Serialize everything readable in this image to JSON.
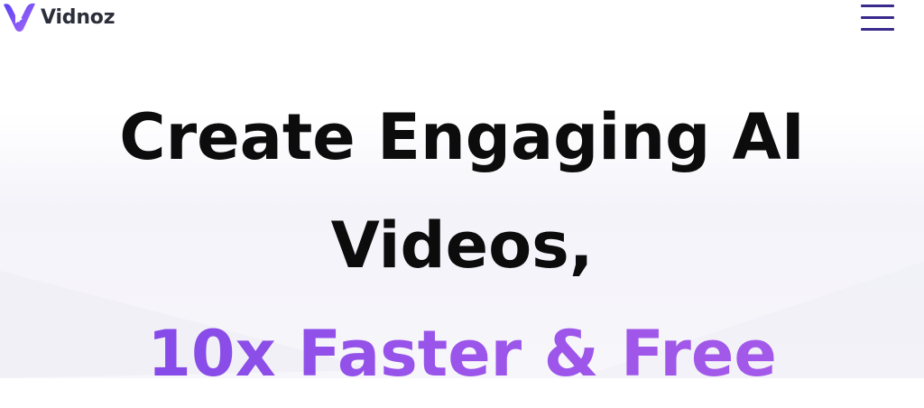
{
  "brand": {
    "name": "Vidnoz",
    "logo_colors": [
      "#5b3ff5",
      "#a56cf7",
      "#ffffff"
    ],
    "text_color": "#2b2f3a"
  },
  "nav": {
    "menu_icon": "hamburger-icon",
    "menu_color": "#3a2a8c"
  },
  "hero": {
    "line1": "Create Engaging AI",
    "line2": "Videos,",
    "line3": "10x Faster & Free",
    "text_color": "#0c0c0d",
    "accent_gradient": [
      "#7a45e6",
      "#a75be8"
    ]
  }
}
